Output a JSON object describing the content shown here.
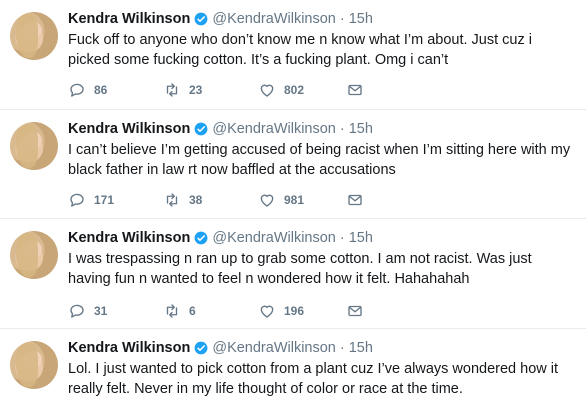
{
  "tweets": [
    {
      "name": "Kendra Wilkinson",
      "handle": "@KendraWilkinson",
      "time": "15h",
      "text": "Fuck off to anyone who don’t know me n know what I’m about. Just cuz i picked some fucking cotton. It’s a fucking plant. Omg i can’t",
      "replies": "86",
      "retweets": "23",
      "likes": "802"
    },
    {
      "name": "Kendra Wilkinson",
      "handle": "@KendraWilkinson",
      "time": "15h",
      "text": "I can’t believe I’m getting accused of being racist when I’m sitting here with my black father in law rt now baffled at the accusations",
      "replies": "171",
      "retweets": "38",
      "likes": "981"
    },
    {
      "name": "Kendra Wilkinson",
      "handle": "@KendraWilkinson",
      "time": "15h",
      "text": "I was trespassing n ran up to grab some cotton. I am not racist. Was just having fun n wanted to feel n wondered how it felt. Hahahahah",
      "replies": "31",
      "retweets": "6",
      "likes": "196"
    },
    {
      "name": "Kendra Wilkinson",
      "handle": "@KendraWilkinson",
      "time": "15h",
      "text": "Lol. I just wanted to pick cotton from a plant cuz I’ve always wondered how it really felt. Never in my life thought of color or race at the time.",
      "replies": "",
      "retweets": "",
      "likes": ""
    }
  ],
  "icons": {
    "verified": "verified-badge-icon",
    "reply": "reply-icon",
    "retweet": "retweet-icon",
    "like": "heart-icon",
    "dm": "envelope-icon"
  },
  "colors": {
    "verified": "#1da1f2",
    "muted": "#657786",
    "text": "#14171a",
    "divider": "#e6ecf0"
  }
}
